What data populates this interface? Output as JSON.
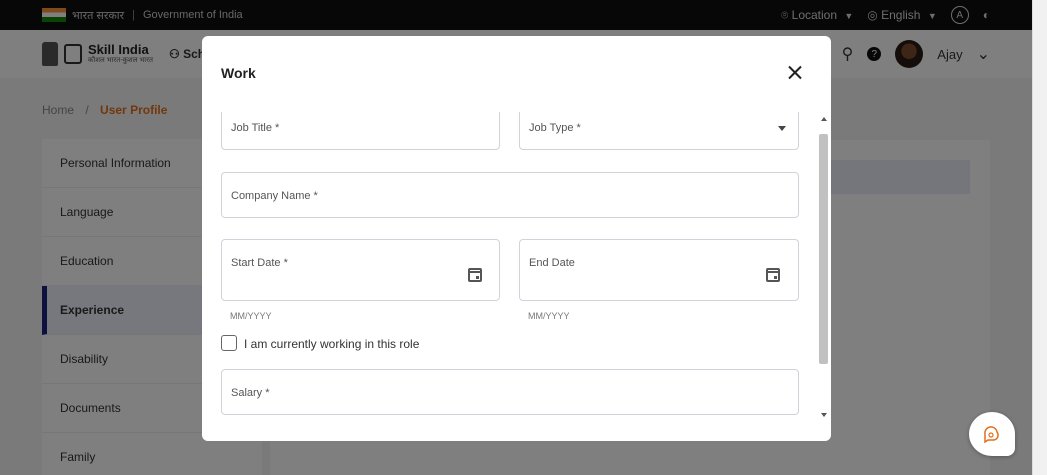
{
  "gov_bar": {
    "hindi": "भारत सरकार",
    "english": "Government of India",
    "location_label": "Location",
    "language_label": "English",
    "accessibility_letter": "A"
  },
  "header": {
    "logo_text": "Skill India",
    "logo_sub": "कौशल भारत-कुशल भारत",
    "nav_schemes": "Sch",
    "help_symbol": "?",
    "user_name": "Ajay"
  },
  "breadcrumb": {
    "home": "Home",
    "separator": "/",
    "current": "User Profile"
  },
  "sidebar": {
    "items": [
      {
        "label": "Personal Information"
      },
      {
        "label": "Language"
      },
      {
        "label": "Education"
      },
      {
        "label": "Experience"
      },
      {
        "label": "Disability"
      },
      {
        "label": "Documents"
      },
      {
        "label": "Family"
      }
    ],
    "active_index": 3,
    "active_color": "#1a237e"
  },
  "modal": {
    "title": "Work",
    "fields": {
      "job_title": "Job Title *",
      "job_type": "Job Type *",
      "company_name": "Company Name *",
      "start_date": "Start Date *",
      "start_date_hint": "MM/YYYY",
      "end_date": "End Date",
      "end_date_hint": "MM/YYYY",
      "current_role": "I am currently working in this role",
      "salary": "Salary *"
    }
  },
  "colors": {
    "accent": "#e46e1b",
    "overlay": "rgba(0,0,0,0.5)"
  }
}
